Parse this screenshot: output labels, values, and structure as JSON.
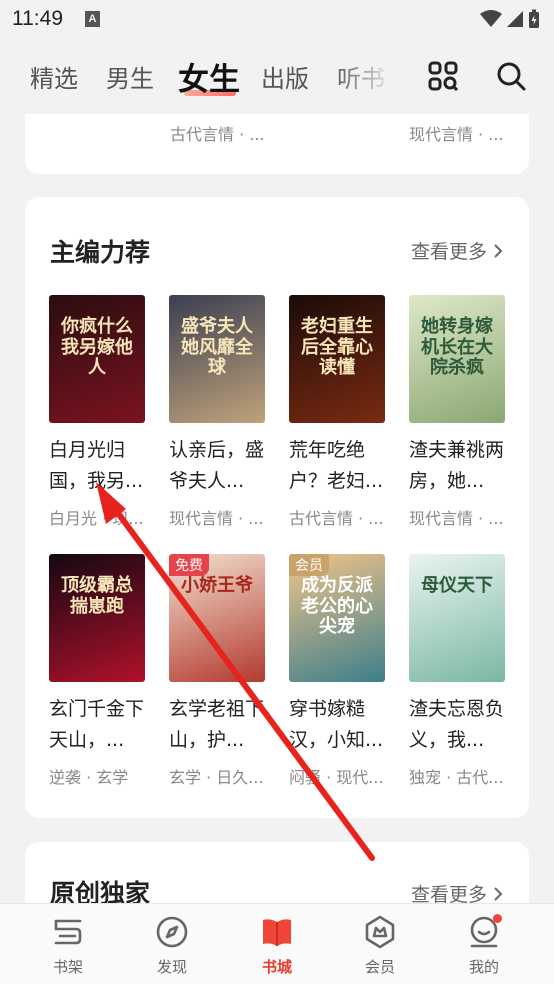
{
  "status_bar": {
    "time": "11:49",
    "notif_letter": "A"
  },
  "top_nav": {
    "tabs": [
      {
        "label": "精选"
      },
      {
        "label": "男生"
      },
      {
        "label": "女生"
      },
      {
        "label": "出版"
      },
      {
        "label": "听书"
      }
    ],
    "active_tab": "女生"
  },
  "previous_card": {
    "tags": [
      "古代言情 · ...",
      "现代言情 · ..."
    ]
  },
  "section": {
    "title": "主编力荐",
    "more_label": "查看更多",
    "books": [
      {
        "cover_text": "你疯什么我另嫁他人",
        "title": "白月光归国，我另...",
        "tags": "白月光 · 现...",
        "badge": "",
        "cover_colors": [
          "#2a0d10",
          "#7b1320"
        ]
      },
      {
        "cover_text": "盛爷夫人她风靡全球",
        "title": "认亲后，盛爷夫人...",
        "tags": "现代言情 · ...",
        "badge": "",
        "cover_colors": [
          "#3a3f52",
          "#c0a27a"
        ]
      },
      {
        "cover_text": "老妇重生后全靠心读懂",
        "title": "荒年吃绝户？老妇...",
        "tags": "古代言情 · ...",
        "badge": "",
        "cover_colors": [
          "#1a0c08",
          "#7a2a12"
        ]
      },
      {
        "cover_text": "她转身嫁机长在大院杀疯",
        "title": "渣夫兼祧两房，她...",
        "tags": "现代言情 · ...",
        "badge": "",
        "cover_colors": [
          "#dfe8c9",
          "#8aa873"
        ]
      },
      {
        "cover_text": "顶级霸总揣崽跑",
        "title": "玄门千金下天山，...",
        "tags": "逆袭 · 玄学",
        "badge": "",
        "cover_colors": [
          "#140812",
          "#b0112a"
        ]
      },
      {
        "cover_text": "小娇王爷",
        "title": "玄学老祖下山，护...",
        "tags": "玄学 · 日久...",
        "badge": "免费",
        "badge_color": "#e8424c",
        "cover_colors": [
          "#f3e2d2",
          "#b23a2e"
        ]
      },
      {
        "cover_text": "成为反派老公的心尖宠",
        "title": "穿书嫁糙汉，小知...",
        "tags": "闷骚 · 现代...",
        "badge": "会员",
        "badge_color": "#c9a36a",
        "cover_colors": [
          "#f1c48a",
          "#3d7f8a"
        ]
      },
      {
        "cover_text": "母仪天下",
        "title": "渣夫忘恩负义，我...",
        "tags": "独宠 · 古代...",
        "badge": "",
        "cover_colors": [
          "#eaf4ef",
          "#7ab7a5"
        ]
      }
    ]
  },
  "next_section": {
    "title": "原创独家",
    "more_label": "查看更多"
  },
  "bottom_nav": {
    "items": [
      {
        "label": "书架",
        "icon": "bookshelf-icon"
      },
      {
        "label": "发现",
        "icon": "compass-icon"
      },
      {
        "label": "书城",
        "icon": "bookstore-icon"
      },
      {
        "label": "会员",
        "icon": "vip-icon"
      },
      {
        "label": "我的",
        "icon": "profile-icon"
      }
    ],
    "active": "书城"
  },
  "annotation": {
    "arrow_color": "#e8231d"
  }
}
